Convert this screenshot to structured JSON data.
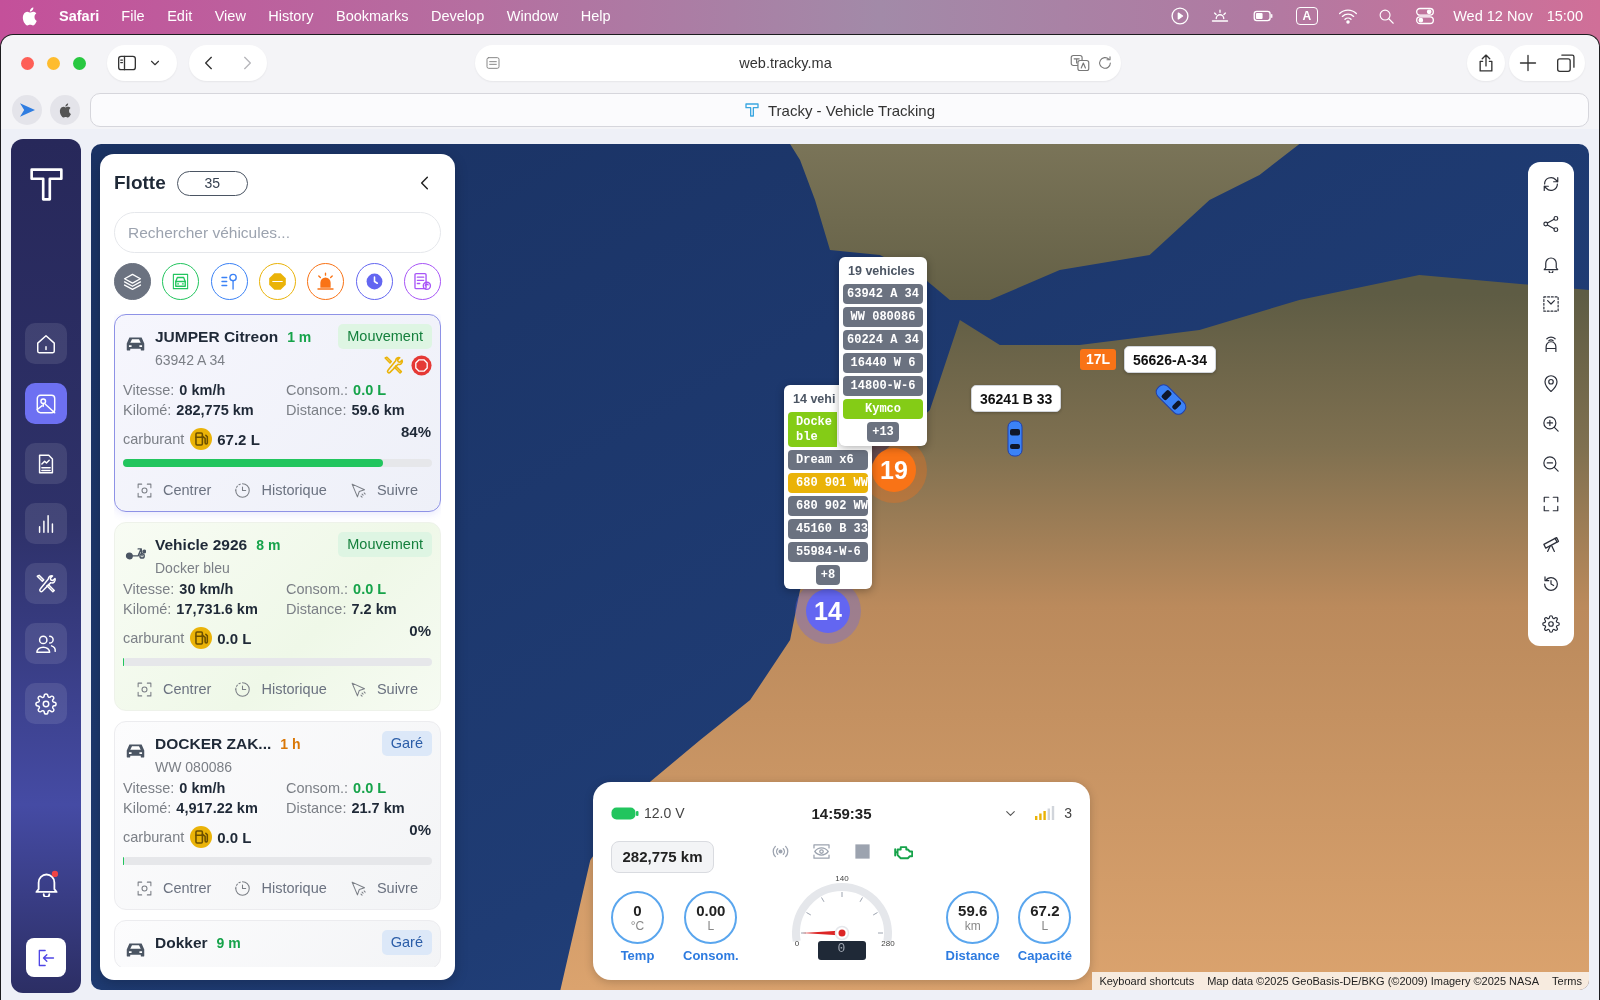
{
  "menubar": {
    "app": "Safari",
    "menus": [
      "File",
      "Edit",
      "View",
      "History",
      "Bookmarks",
      "Develop",
      "Window",
      "Help"
    ],
    "input_source": "A",
    "date": "Wed 12 Nov",
    "time": "15:00"
  },
  "browser": {
    "url": "web.tracky.ma",
    "tab_title": "Tracky - Vehicle Tracking"
  },
  "nav": {
    "items": [
      {
        "kind": "home",
        "selected": false
      },
      {
        "kind": "map",
        "selected": true
      },
      {
        "kind": "reports",
        "selected": false
      },
      {
        "kind": "statistics",
        "selected": false
      },
      {
        "kind": "maintenance",
        "selected": false
      },
      {
        "kind": "drivers",
        "selected": false
      },
      {
        "kind": "settings",
        "selected": false
      }
    ],
    "alerts": {
      "unread": true
    }
  },
  "fleet": {
    "title": "Flotte",
    "count": "35",
    "search": {
      "placeholder": "Rechercher véhicules..."
    },
    "filters": [
      {
        "kind": "all",
        "color": "#6b7280",
        "selected": true
      },
      {
        "kind": "moving",
        "color": "#22c55e",
        "selected": false
      },
      {
        "kind": "parked",
        "color": "#3b82f6",
        "selected": false
      },
      {
        "kind": "stopped",
        "color": "#eab308",
        "selected": false
      },
      {
        "kind": "alarm",
        "color": "#f97316",
        "selected": false
      },
      {
        "kind": "idle",
        "color": "#6366f1",
        "selected": false
      },
      {
        "kind": "reports",
        "color": "#a855f7",
        "selected": false
      }
    ],
    "vehicles": [
      {
        "kind": "car",
        "name": "JUMPER Citreon",
        "selected": true,
        "time": {
          "text": "1 m",
          "color": "#16a34a"
        },
        "status": {
          "kind": "moving",
          "label": "Mouvement"
        },
        "plate": "63942 A 34",
        "alerts": [
          {
            "kind": "maintenance"
          },
          {
            "kind": "stop"
          }
        ],
        "stats": [
          {
            "label": "Vitesse:",
            "value": "0 km/h",
            "highlight": false
          },
          {
            "label": "Consom.:",
            "value": "0.0 L",
            "highlight": true
          },
          {
            "label": "Kilomé:",
            "value": "282,775 km",
            "highlight": false
          },
          {
            "label": "Distance:",
            "value": "59.6 km",
            "highlight": false
          }
        ],
        "fuel": {
          "label": "carburant",
          "amount": "67.2 L",
          "percent": "84%",
          "level": 0.84
        },
        "actions": [
          {
            "kind": "center",
            "label": "Centrer"
          },
          {
            "kind": "history",
            "label": "Historique"
          },
          {
            "kind": "follow",
            "label": "Suivre"
          }
        ]
      },
      {
        "kind": "motorbike",
        "name": "Vehicle 2926",
        "selected": false,
        "time": {
          "text": "8 m",
          "color": "#16a34a"
        },
        "status": {
          "kind": "moving",
          "label": "Mouvement"
        },
        "plate": "Docker bleu",
        "stats": [
          {
            "label": "Vitesse:",
            "value": "30 km/h",
            "highlight": false
          },
          {
            "label": "Consom.:",
            "value": "0.0 L",
            "highlight": true
          },
          {
            "label": "Kilomé:",
            "value": "17,731.6 km",
            "highlight": false
          },
          {
            "label": "Distance:",
            "value": "7.2 km",
            "highlight": false
          }
        ],
        "fuel": {
          "label": "carburant",
          "amount": "0.0 L",
          "percent": "0%",
          "level": 0
        },
        "actions": [
          {
            "kind": "center",
            "label": "Centrer"
          },
          {
            "kind": "history",
            "label": "Historique"
          },
          {
            "kind": "follow",
            "label": "Suivre"
          }
        ]
      },
      {
        "kind": "car",
        "name": "DOCKER ZAK...",
        "selected": false,
        "time": {
          "text": "1 h",
          "color": "#d97706"
        },
        "status": {
          "kind": "parked",
          "label": "Garé"
        },
        "plate": "WW 080086",
        "stats": [
          {
            "label": "Vitesse:",
            "value": "0 km/h",
            "highlight": false
          },
          {
            "label": "Consom.:",
            "value": "0.0 L",
            "highlight": true
          },
          {
            "label": "Kilomé:",
            "value": "4,917.22 km",
            "highlight": false
          },
          {
            "label": "Distance:",
            "value": "21.7 km",
            "highlight": false
          }
        ],
        "fuel": {
          "label": "carburant",
          "amount": "0.0 L",
          "percent": "0%",
          "level": 0
        },
        "actions": [
          {
            "kind": "center",
            "label": "Centrer"
          },
          {
            "kind": "history",
            "label": "Historique"
          },
          {
            "kind": "follow",
            "label": "Suivre"
          }
        ]
      },
      {
        "kind": "car",
        "name": "Dokker",
        "selected": false,
        "time": {
          "text": "9 m",
          "color": "#16a34a"
        },
        "status": {
          "kind": "parked",
          "label": "Garé"
        }
      }
    ]
  },
  "map": {
    "clusters": [
      {
        "count": "19",
        "color": "#f97316",
        "title": "19 vehicles",
        "items": [
          {
            "label": "63942 A 34",
            "color": "#6b7280"
          },
          {
            "label": "WW 080086",
            "color": "#6b7280"
          },
          {
            "label": "60224 A 34",
            "color": "#6b7280"
          },
          {
            "label": "16440 W 6",
            "color": "#6b7280"
          },
          {
            "label": "14800-W-6",
            "color": "#6b7280"
          },
          {
            "label": "Kymco",
            "color": "#84cc16"
          }
        ],
        "more": "+13"
      },
      {
        "count": "14",
        "color": "#6366f1",
        "title": "14 vehi",
        "items": [
          {
            "label": "Docke\nble",
            "color": "#84cc16"
          },
          {
            "label": "Dream x6",
            "color": "#6b7280"
          },
          {
            "label": "680 901 WW",
            "color": "#eab308"
          },
          {
            "label": "680 902 WW",
            "color": "#6b7280"
          },
          {
            "label": "45160 B 33",
            "color": "#6b7280"
          },
          {
            "label": "55984-W-6",
            "color": "#6b7280"
          }
        ],
        "more": "+8"
      }
    ],
    "markers": [
      {
        "plate": "36241 B 33"
      },
      {
        "plate": "56626-A-34",
        "fuel": "17L"
      }
    ],
    "tools": [
      {
        "kind": "refresh"
      },
      {
        "kind": "route"
      },
      {
        "kind": "alerts"
      },
      {
        "kind": "select"
      },
      {
        "kind": "driver"
      },
      {
        "kind": "pin"
      },
      {
        "kind": "zoom_in"
      },
      {
        "kind": "zoom_out"
      },
      {
        "kind": "fullscreen"
      },
      {
        "kind": "explore"
      },
      {
        "kind": "history"
      },
      {
        "kind": "settings"
      }
    ],
    "attribution": {
      "shortcuts": "Keyboard shortcuts",
      "credit": "Map data ©2025 GeoBasis-DE/BKG (©2009) Imagery ©2025 NASA",
      "terms": "Terms"
    }
  },
  "dashboard": {
    "voltage": "12.0 V",
    "clock": "14:59:35",
    "signal": "3",
    "odometer": "282,775 km",
    "indicators": [
      {
        "kind": "gps",
        "on": false
      },
      {
        "kind": "camera",
        "on": false
      },
      {
        "kind": "door",
        "on": false
      },
      {
        "kind": "engine",
        "on": true
      }
    ],
    "gauges": [
      {
        "value": "0",
        "unit": "°C",
        "label": "Temp"
      },
      {
        "value": "0.00",
        "unit": "L",
        "label": "Consom."
      },
      {
        "value": "59.6",
        "unit": "km",
        "label": "Distance"
      },
      {
        "value": "67.2",
        "unit": "L",
        "label": "Capacité"
      }
    ],
    "speedometer": {
      "scale": [
        "0",
        "140",
        "280"
      ],
      "reading": "0"
    }
  }
}
